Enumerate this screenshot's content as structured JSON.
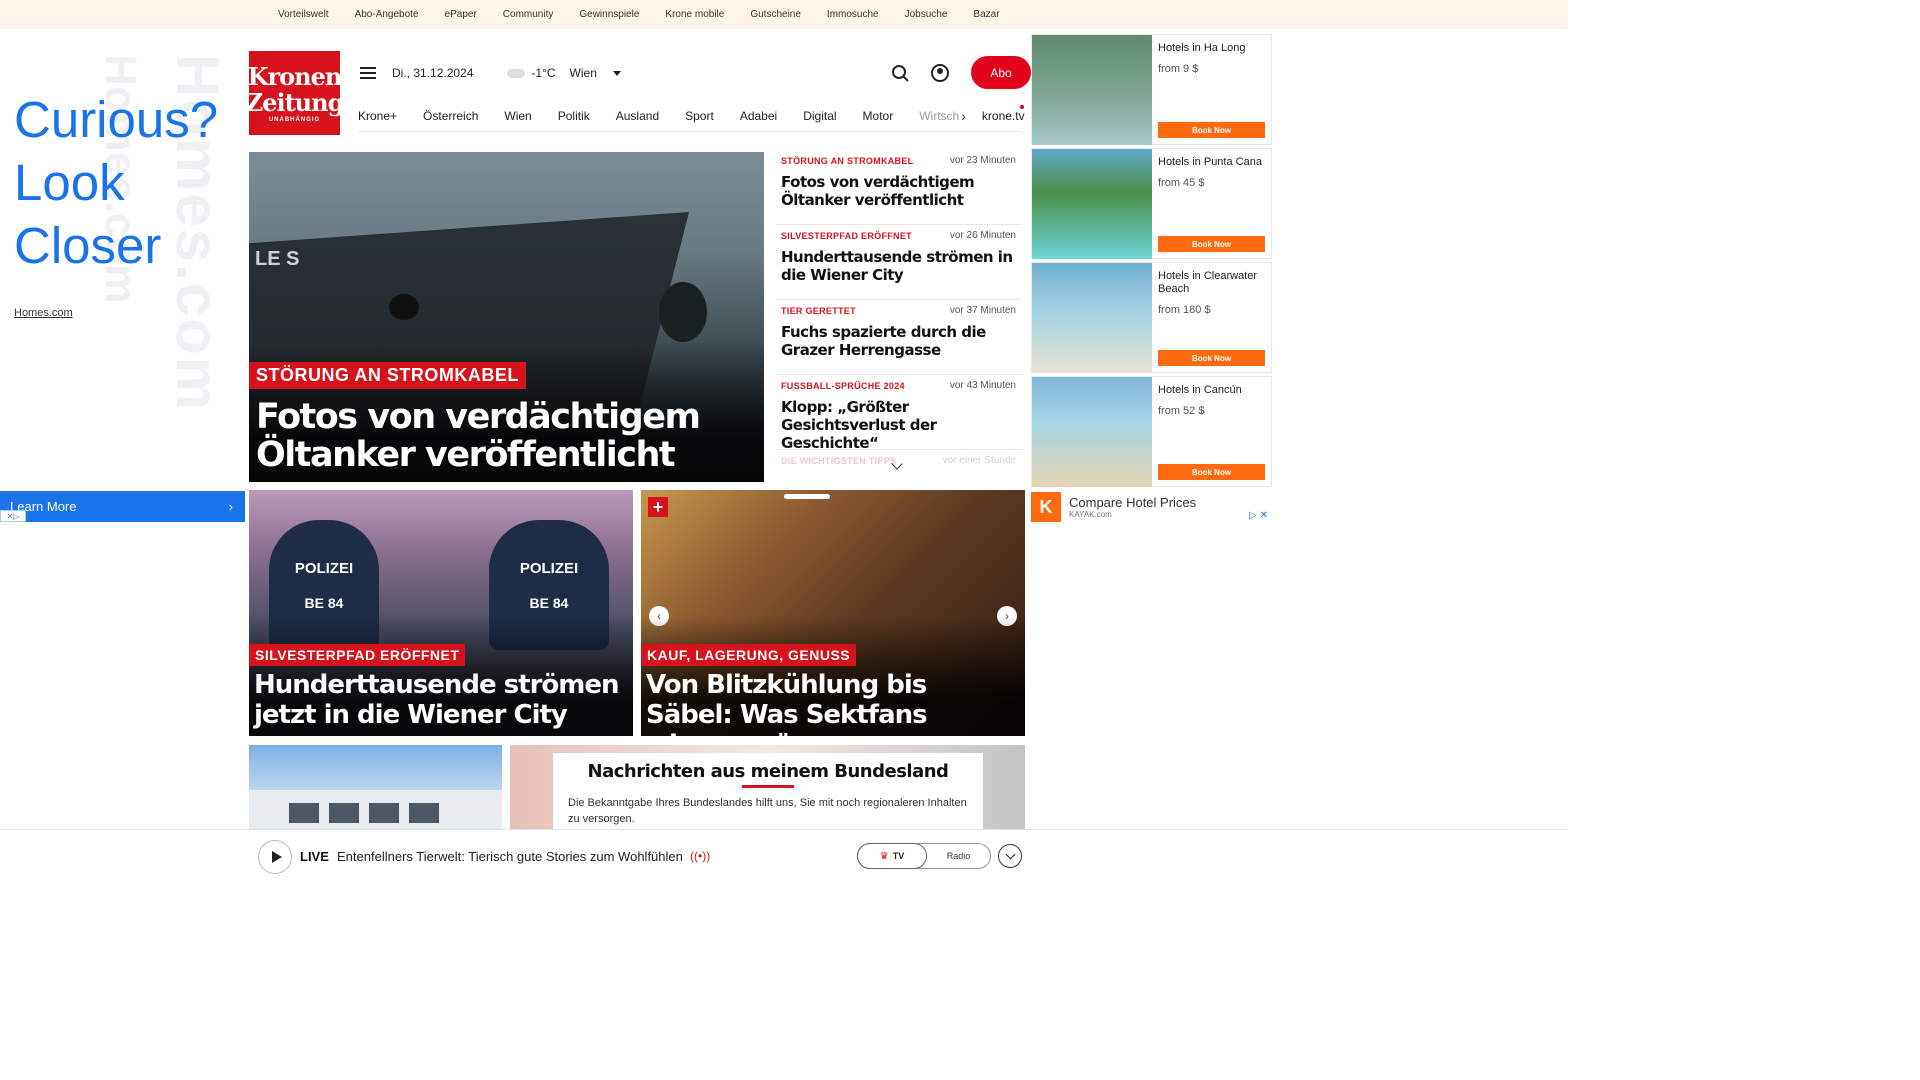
{
  "topbar": {
    "links": [
      "Vorteilswelt",
      "Abo-Angebote",
      "ePaper",
      "Community",
      "Gewinnspiele",
      "Krone mobile",
      "Gutscheine",
      "Immosuche",
      "Jobsuche",
      "Bazar"
    ]
  },
  "left_ad": {
    "headline_line1": "Curious?",
    "headline_line2": "Look",
    "headline_line3": "Closer",
    "watermark": "Homes.com",
    "brand_link": "Homes.com",
    "cta": "Learn More"
  },
  "logo": {
    "line1": "Kronen",
    "line2": "Zeitung",
    "tagline": "UNABHÄNGIG"
  },
  "header": {
    "date": "Di., 31.12.2024",
    "temperature": "-1°C",
    "city": "Wien",
    "abo_label": "Abo"
  },
  "nav": {
    "items": [
      "Krone+",
      "Österreich",
      "Wien",
      "Politik",
      "Ausland",
      "Sport",
      "Adabei",
      "Digital",
      "Motor",
      "Wirtsch"
    ],
    "tv": "krone.tv"
  },
  "hero": {
    "hull_mark": "LE S",
    "tag": "STÖRUNG AN STROMKABEL",
    "title": "Fotos von verdächtigem Öltanker veröffentlicht"
  },
  "news": [
    {
      "kat": "STÖRUNG AN STROMKABEL",
      "time": "vor 23 Minuten",
      "title": "Fotos von verdächtigem Öltanker veröffentlicht"
    },
    {
      "kat": "SILVESTERPFAD ERÖFFNET",
      "time": "vor 26 Minuten",
      "title": "Hunderttausende strömen in die Wiener City"
    },
    {
      "kat": "TIER GERETTET",
      "time": "vor 37 Minuten",
      "title": "Fuchs spazierte durch die Grazer Herrengasse"
    },
    {
      "kat": "FUSSBALL-SPRÜCHE 2024",
      "time": "vor 43 Minuten",
      "title": "Klopp: „Größter Gesichtsverlust der Geschichte“"
    },
    {
      "kat": "DIE WICHTIGSTEN TIPPS",
      "time": "vor einer Stunde",
      "title": ""
    }
  ],
  "cards": [
    {
      "tag": "SILVESTERPFAD ERÖFFNET",
      "title": "Hunderttausende strömen jetzt in die Wiener City",
      "cop1": "POLIZEI",
      "cop1_id": "BE 84",
      "cop2": "POLIZEI",
      "cop2_id": "BE 84"
    },
    {
      "tag": "KAUF, LAGERUNG, GENUSS",
      "title": "Von Blitzkühlung bis Säbel: Was Sektfans wissen müssen"
    }
  ],
  "bundesland": {
    "title": "Nachrichten aus meinem Bundesland",
    "text": "Die Bekanntgabe Ihres Bundeslandes hilft uns, Sie mit noch regionaleren Inhalten zu versorgen."
  },
  "hotels": [
    {
      "name": "Hotels in Ha Long",
      "price": "from 9 $",
      "cta": "Book Now",
      "colors": [
        "#5f8b6f",
        "#a6c7c9"
      ]
    },
    {
      "name": "Hotels in Punta Cana",
      "price": "from 45 $",
      "cta": "Book Now",
      "colors": [
        "#5fa8c8",
        "#6ed6d8"
      ]
    },
    {
      "name": "Hotels in Clearwater Beach",
      "price": "from 180 $",
      "cta": "Book Now",
      "colors": [
        "#6fb1cf",
        "#e8e2d4"
      ]
    },
    {
      "name": "Hotels in Cancún",
      "price": "from 52 $",
      "cta": "Book Now",
      "colors": [
        "#7db8d8",
        "#e6d6b4"
      ]
    }
  ],
  "kayak": {
    "letter": "K",
    "title": "Compare Hotel Prices",
    "source": "KAYAK.com",
    "adx": "▷ ✕"
  },
  "player": {
    "live": "LIVE",
    "title": "Entenfellners Tierwelt: Tierisch gute Stories zum Wohlfühlen",
    "tv": "TV",
    "radio": "Radio"
  },
  "colors": {
    "brand_red": "#d6131c",
    "abo_red": "#e2001a",
    "ad_blue": "#1a73e8",
    "kayak_orange": "#ff690f"
  }
}
